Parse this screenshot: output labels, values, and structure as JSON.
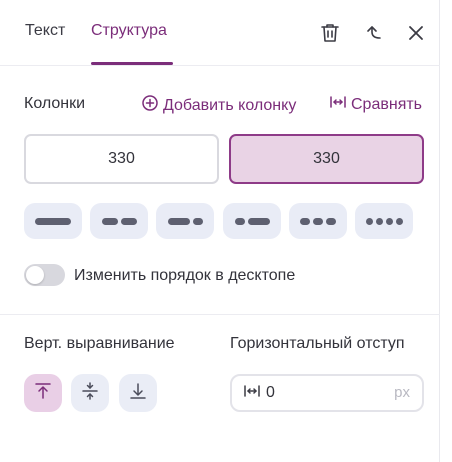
{
  "tabs": [
    {
      "label": "Текст",
      "active": false
    },
    {
      "label": "Структура",
      "active": true
    }
  ],
  "header_icons": [
    "trash-icon",
    "move-up-icon",
    "close-icon"
  ],
  "columns": {
    "label": "Колонки",
    "add_label": "Добавить колонку",
    "equalize_label": "Сравнять",
    "items": [
      {
        "value": "330",
        "selected": false
      },
      {
        "value": "330",
        "selected": true
      }
    ]
  },
  "layouts": [
    {
      "name": "one-column"
    },
    {
      "name": "two-equal"
    },
    {
      "name": "wide-narrow"
    },
    {
      "name": "narrow-wide"
    },
    {
      "name": "three-equal"
    },
    {
      "name": "four-equal"
    }
  ],
  "reorder": {
    "label": "Изменить порядок в десктопе",
    "enabled": false
  },
  "vertical_align": {
    "label": "Верт. выравнивание",
    "options": [
      {
        "name": "top",
        "active": true
      },
      {
        "name": "center",
        "active": false
      },
      {
        "name": "bottom",
        "active": false
      }
    ]
  },
  "horizontal_gap": {
    "label": "Горизонтальный отступ",
    "value": "0",
    "unit": "px"
  },
  "colors": {
    "accent": "#7b2d7a",
    "selected_bg": "#e9d3e5",
    "button_bg": "#e9ecf6"
  }
}
